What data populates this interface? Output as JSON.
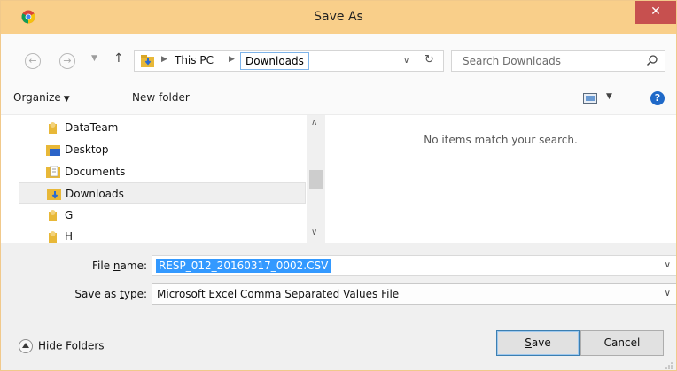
{
  "window": {
    "title": "Save As",
    "close_label": "✕",
    "app_icon": "chrome-icon"
  },
  "navigation": {
    "back_icon": "back-arrow-icon",
    "forward_icon": "forward-arrow-icon",
    "recent_icon": "chevron-down-icon",
    "up_icon": "up-arrow-icon"
  },
  "address": {
    "breadcrumbs": [
      "This PC",
      "Downloads"
    ],
    "separator": "▶",
    "refresh_icon": "refresh-icon"
  },
  "search": {
    "placeholder": "Search Downloads",
    "icon": "search-icon"
  },
  "toolbar": {
    "organize_label": "Organize",
    "new_folder_label": "New folder",
    "help_label": "?"
  },
  "nav_pane": {
    "items": [
      {
        "label": "DataTeam",
        "icon": "user-folder-icon",
        "selected": false
      },
      {
        "label": "Desktop",
        "icon": "desktop-folder-icon",
        "selected": false
      },
      {
        "label": "Documents",
        "icon": "documents-folder-icon",
        "selected": false
      },
      {
        "label": "Downloads",
        "icon": "downloads-folder-icon",
        "selected": true
      },
      {
        "label": "G",
        "icon": "user-folder-icon",
        "selected": false
      },
      {
        "label": "H",
        "icon": "user-folder-icon",
        "selected": false
      }
    ]
  },
  "content": {
    "empty_message": "No items match your search."
  },
  "form": {
    "file_name_label_pre": "File ",
    "file_name_label_key": "n",
    "file_name_label_post": "ame:",
    "file_name_value": "RESP_012_20160317_0002.CSV",
    "save_type_label_pre": "Save as ",
    "save_type_label_key": "t",
    "save_type_label_post": "ype:",
    "save_type_value": "Microsoft Excel Comma Separated Values File"
  },
  "footer": {
    "hide_folders_label": "Hide Folders",
    "save_key": "S",
    "save_rest": "ave",
    "cancel_label": "Cancel"
  },
  "colors": {
    "titlebar": "#f9cf8a",
    "close": "#c7504f",
    "selection": "#3399ff",
    "folder": "#e8b838"
  }
}
